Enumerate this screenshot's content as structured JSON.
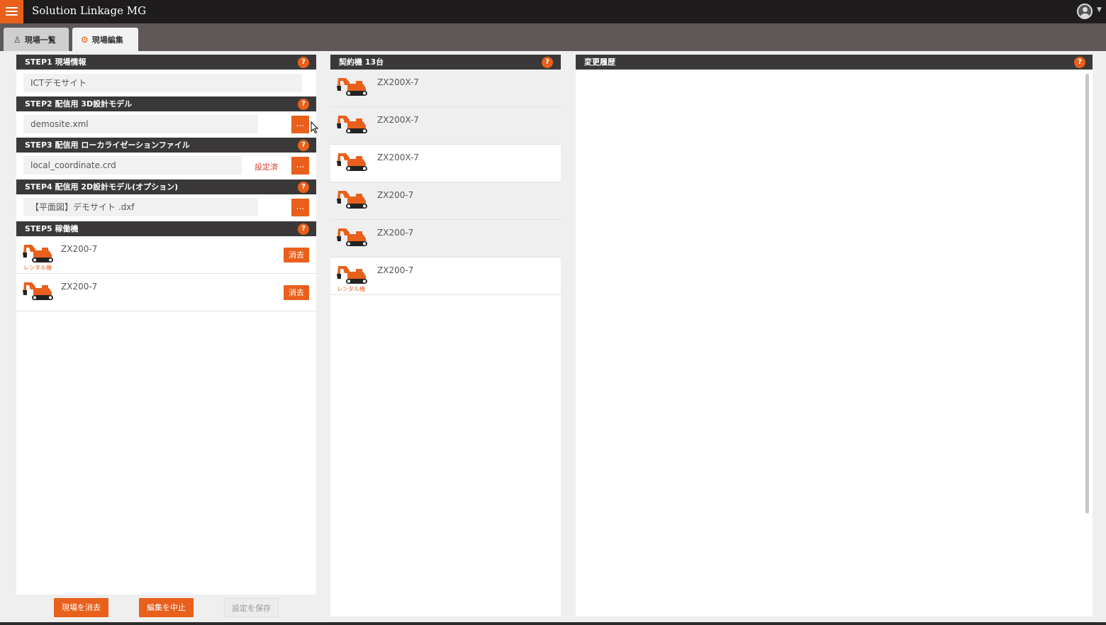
{
  "app": {
    "title": "Solution Linkage MG"
  },
  "tabs": [
    {
      "label": "現場一覧"
    },
    {
      "label": "現場編集"
    }
  ],
  "steps": {
    "step1": {
      "title": "STEP1 現場情報",
      "value": "ICTデモサイト"
    },
    "step2": {
      "title": "STEP2 配信用 3D設計モデル",
      "value": "demosite.xml",
      "button": "…"
    },
    "step3": {
      "title": "STEP3 配信用 ローカライゼーションファイル",
      "value": "local_coordinate.crd",
      "status": "設定済",
      "button": "…"
    },
    "step4": {
      "title": "STEP4 配信用 2D設計モデル(オプション)",
      "value": "【平面図】デモサイト .dxf",
      "button": "…"
    },
    "step5": {
      "title": "STEP5 稼働機",
      "machines": [
        {
          "name": "ZX200-7",
          "rental": "レンタル機",
          "delete": "消去"
        },
        {
          "name": "ZX200-7",
          "rental": "",
          "delete": "消去"
        }
      ]
    }
  },
  "contract": {
    "title": "契約機 13台",
    "machines": [
      {
        "name": "ZX200X-7",
        "rental": ""
      },
      {
        "name": "ZX200X-7",
        "rental": ""
      },
      {
        "name": "ZX200X-7",
        "rental": ""
      },
      {
        "name": "ZX200-7",
        "rental": ""
      },
      {
        "name": "ZX200-7",
        "rental": ""
      },
      {
        "name": "ZX200-7",
        "rental": "レンタル機"
      }
    ]
  },
  "history": {
    "title": "変更履歴"
  },
  "help_label": "?",
  "buttons": {
    "delete_site": "現場を消去",
    "cancel_edit": "編集を中止",
    "save_settings": "設定を保存"
  },
  "colors": {
    "accent": "#e8601c",
    "header": "#3a3838",
    "topbar": "#1e1c1c",
    "tabbar": "#5f5858"
  }
}
